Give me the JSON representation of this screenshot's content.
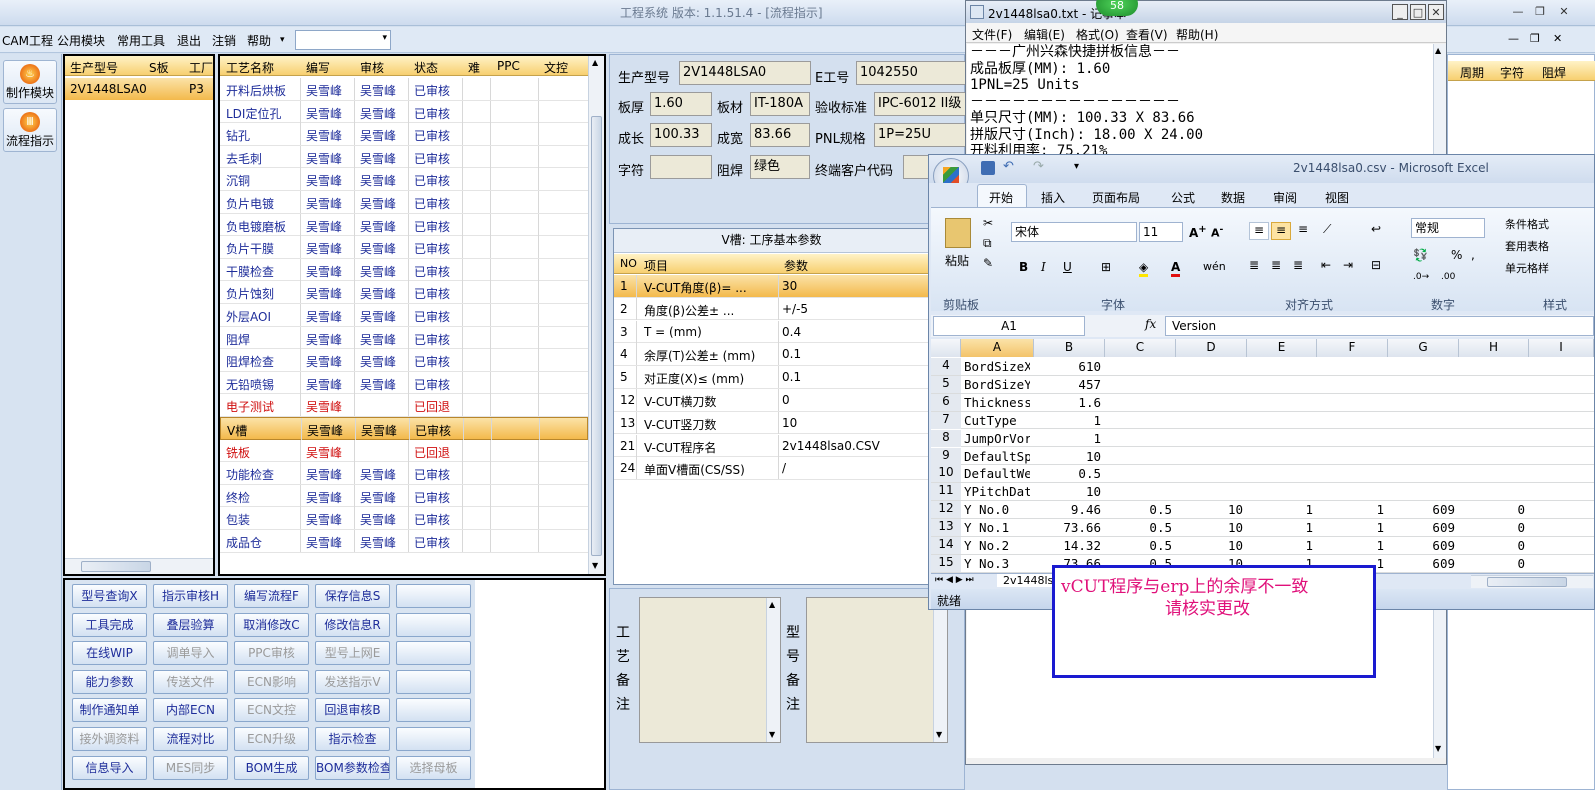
{
  "app": {
    "title": "工程系统 版本: 1.1.51.4 - [流程指示]"
  },
  "menu": [
    "CAM工程",
    "公用模块",
    "常用工具",
    "退出",
    "注销",
    "帮助"
  ],
  "left_buttons": [
    {
      "label": "制作模块",
      "icon": "flame-icon"
    },
    {
      "label": "流程指示",
      "icon": "flow-icon"
    }
  ],
  "model_list": {
    "headers": [
      "生产型号",
      "S板",
      "工厂"
    ],
    "rows": [
      {
        "model": "2V1448LSA0",
        "s": "",
        "factory": "P3"
      }
    ]
  },
  "process": {
    "headers": [
      "工艺名称",
      "编写",
      "审核",
      "状态",
      "难",
      "PPC",
      "文控"
    ],
    "rows": [
      {
        "name": "开料后烘板",
        "writer": "吴雪峰",
        "auditor": "吴雪峰",
        "status": "已审核",
        "color": "blue"
      },
      {
        "name": "LDI定位孔",
        "writer": "吴雪峰",
        "auditor": "吴雪峰",
        "status": "已审核",
        "color": "blue"
      },
      {
        "name": "钻孔",
        "writer": "吴雪峰",
        "auditor": "吴雪峰",
        "status": "已审核",
        "color": "blue"
      },
      {
        "name": "去毛刺",
        "writer": "吴雪峰",
        "auditor": "吴雪峰",
        "status": "已审核",
        "color": "blue"
      },
      {
        "name": "沉铜",
        "writer": "吴雪峰",
        "auditor": "吴雪峰",
        "status": "已审核",
        "color": "blue"
      },
      {
        "name": "负片电镀",
        "writer": "吴雪峰",
        "auditor": "吴雪峰",
        "status": "已审核",
        "color": "blue"
      },
      {
        "name": "负电镀磨板",
        "writer": "吴雪峰",
        "auditor": "吴雪峰",
        "status": "已审核",
        "color": "blue"
      },
      {
        "name": "负片干膜",
        "writer": "吴雪峰",
        "auditor": "吴雪峰",
        "status": "已审核",
        "color": "blue"
      },
      {
        "name": "干膜检查",
        "writer": "吴雪峰",
        "auditor": "吴雪峰",
        "status": "已审核",
        "color": "blue"
      },
      {
        "name": "负片蚀刻",
        "writer": "吴雪峰",
        "auditor": "吴雪峰",
        "status": "已审核",
        "color": "blue"
      },
      {
        "name": "外层AOI",
        "writer": "吴雪峰",
        "auditor": "吴雪峰",
        "status": "已审核",
        "color": "blue"
      },
      {
        "name": "阻焊",
        "writer": "吴雪峰",
        "auditor": "吴雪峰",
        "status": "已审核",
        "color": "blue"
      },
      {
        "name": "阻焊检查",
        "writer": "吴雪峰",
        "auditor": "吴雪峰",
        "status": "已审核",
        "color": "blue"
      },
      {
        "name": "无铅喷锡",
        "writer": "吴雪峰",
        "auditor": "吴雪峰",
        "status": "已审核",
        "color": "blue"
      },
      {
        "name": "电子测试",
        "writer": "吴雪峰",
        "auditor": "",
        "status": "已回退",
        "color": "red"
      },
      {
        "name": "V槽",
        "writer": "吴雪峰",
        "auditor": "吴雪峰",
        "status": "已审核",
        "color": "sel"
      },
      {
        "name": "铣板",
        "writer": "吴雪峰",
        "auditor": "",
        "status": "已回退",
        "color": "red"
      },
      {
        "name": "功能检查",
        "writer": "吴雪峰",
        "auditor": "吴雪峰",
        "status": "已审核",
        "color": "blue"
      },
      {
        "name": "终检",
        "writer": "吴雪峰",
        "auditor": "吴雪峰",
        "status": "已审核",
        "color": "blue"
      },
      {
        "name": "包装",
        "writer": "吴雪峰",
        "auditor": "吴雪峰",
        "status": "已审核",
        "color": "blue"
      },
      {
        "name": "成品仓",
        "writer": "吴雪峰",
        "auditor": "吴雪峰",
        "status": "已审核",
        "color": "blue"
      }
    ]
  },
  "buttons": [
    [
      "型号查询X",
      "指示审核H",
      "编写流程F",
      "保存信息S",
      ""
    ],
    [
      "工具完成",
      "叠层验算",
      "取消修改C",
      "修改信息R",
      ""
    ],
    [
      "在线WIP",
      "调单导入",
      "PPC审核",
      "型号上网E",
      ""
    ],
    [
      "能力参数",
      "传送文件",
      "ECN影响",
      "发送指示V",
      ""
    ],
    [
      "制作通知单",
      "内部ECN",
      "ECN文控",
      "回退审核B",
      ""
    ],
    [
      "接外调资料",
      "流程对比",
      "ECN升级",
      "指示检查",
      ""
    ],
    [
      "信息导入",
      "MES同步",
      "BOM生成",
      "BOM参数检查",
      "选择母板"
    ]
  ],
  "buttons_disabled": [
    "调单导入",
    "PPC审核",
    "型号上网E",
    "传送文件",
    "ECN影响",
    "发送指示V",
    "ECN文控",
    "接外调资料",
    "ECN升级",
    "MES同步",
    "选择母板"
  ],
  "info": {
    "model_label": "生产型号",
    "model": "2V1448LSA0",
    "eno_label": "E工号",
    "eno": "1042550",
    "thick_label": "板厚",
    "thick": "1.60",
    "mat_label": "板材",
    "mat": "IT-180A",
    "std_label": "验收标准",
    "std": "IPC-6012 II级",
    "len_label": "成长",
    "len": "100.33",
    "wid_label": "成宽",
    "wid": "83.66",
    "pnl_label": "PNL规格",
    "pnl": "1P=25U",
    "char_label": "字符",
    "char": "",
    "mask_label": "阻焊",
    "mask": "绿色",
    "cust_label": "终端客户代码",
    "cust": ""
  },
  "vcut": {
    "title": "V槽: 工序基本参数",
    "headers": [
      "NO",
      "项目",
      "参数"
    ],
    "rows": [
      {
        "no": "1",
        "item": "V-CUT角度(β)= ...",
        "val": "30"
      },
      {
        "no": "2",
        "item": "角度(β)公差± ...",
        "val": "+/-5"
      },
      {
        "no": "3",
        "item": "T = (mm)",
        "val": "0.4"
      },
      {
        "no": "4",
        "item": "余厚(T)公差± (mm)",
        "val": "0.1"
      },
      {
        "no": "5",
        "item": "对正度(X)≤ (mm)",
        "val": "0.1"
      },
      {
        "no": "12",
        "item": "V-CUT横刀数",
        "val": "0"
      },
      {
        "no": "13",
        "item": "V-CUT竖刀数",
        "val": "10"
      },
      {
        "no": "21",
        "item": "V-CUT程序名",
        "val": "2v1448lsa0.CSV"
      },
      {
        "no": "24",
        "item": "单面V槽面(CS/SS)",
        "val": "/"
      }
    ]
  },
  "remarks": {
    "craft": "工艺备注",
    "model": "型号备注"
  },
  "right_headers": [
    "周期",
    "字符",
    "阻焊"
  ],
  "notepad": {
    "title": "2v1448lsa0.txt - 记事本",
    "menu": [
      "文件(F)",
      "编辑(E)",
      "格式(O)",
      "查看(V)",
      "帮助(H)"
    ],
    "lines": [
      "－－－广州兴森快捷拼板信息－－",
      "成品板厚(MM): 1.60",
      "1PNL=25 Units",
      "－－－－－－－－－－－－－－－",
      "单只尺寸(MM): 100.33 X 83.66",
      "拼版尺寸(Inch): 18.00 X 24.00",
      "开料利用率: 75.21%"
    ],
    "badge": "58"
  },
  "excel": {
    "title": "2v1448lsa0.csv - Microsoft Excel",
    "tabs": [
      "开始",
      "插入",
      "页面布局",
      "公式",
      "数据",
      "审阅",
      "视图"
    ],
    "groups": [
      "剪贴板",
      "字体",
      "对齐方式",
      "数字",
      "样式"
    ],
    "font": "宋体",
    "size": "11",
    "numfmt": "常规",
    "paste": "粘贴",
    "styles": [
      "条件格式",
      "套用表格",
      "单元格样"
    ],
    "namebox": "A1",
    "formula": "Version",
    "cols": [
      "A",
      "B",
      "C",
      "D",
      "E",
      "F",
      "G",
      "H",
      "I"
    ],
    "rows": [
      {
        "n": "4",
        "a": "BordSizeX",
        "b": "610"
      },
      {
        "n": "5",
        "a": "BordSizeY",
        "b": "457"
      },
      {
        "n": "6",
        "a": "Thickness",
        "b": "1.6"
      },
      {
        "n": "7",
        "a": "CutType",
        "b": "1"
      },
      {
        "n": "8",
        "a": "JumpOrVor",
        "b": "1"
      },
      {
        "n": "9",
        "a": "DefaultSp",
        "b": "10"
      },
      {
        "n": "10",
        "a": "DefaultWe",
        "b": "0.5"
      },
      {
        "n": "11",
        "a": "YPitchDat",
        "b": "10"
      },
      {
        "n": "12",
        "a": "Y No.0",
        "b": "9.46",
        "c": "0.5",
        "d": "10",
        "e": "1",
        "f": "1",
        "g": "609",
        "h": "0"
      },
      {
        "n": "13",
        "a": "Y No.1",
        "b": "73.66",
        "c": "0.5",
        "d": "10",
        "e": "1",
        "f": "1",
        "g": "609",
        "h": "0"
      },
      {
        "n": "14",
        "a": "Y No.2",
        "b": "14.32",
        "c": "0.5",
        "d": "10",
        "e": "1",
        "f": "1",
        "g": "609",
        "h": "0"
      },
      {
        "n": "15",
        "a": "Y No.3",
        "b": "73.66",
        "c": "0.5",
        "d": "10",
        "e": "1",
        "f": "1",
        "g": "609",
        "h": "0"
      }
    ],
    "sheet": "2v1448ls",
    "status": "就绪"
  },
  "note": {
    "line1": "vCUT程序与erp上的余厚不一致",
    "line2": "请核实更改",
    "color": "#e0107a"
  }
}
